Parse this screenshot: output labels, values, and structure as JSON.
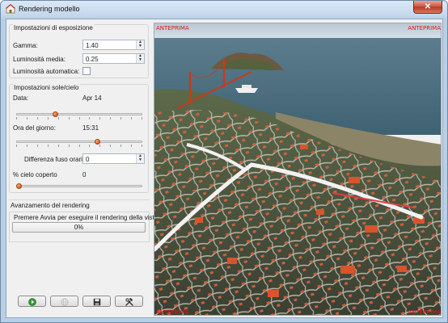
{
  "window": {
    "title": "Rendering modello",
    "close_glyph": "✕"
  },
  "exposure": {
    "group_title": "Impostazioni di esposizione",
    "gamma_label": "Gamma:",
    "gamma_value": "1.40",
    "brightness_label": "Luminosità media:",
    "brightness_value": "0.25",
    "auto_brightness_label": "Luminosità automatica:",
    "auto_brightness_checked": false
  },
  "sun_sky": {
    "group_title": "Impostazioni sole/cielo",
    "date_label": "Data:",
    "date_value": "Apr 14",
    "date_slider_level": 0.3,
    "time_label": "Ora del giorno:",
    "time_value": "15:31",
    "time_slider_level": 0.65,
    "timezone_label": "Differenza fuso orario:",
    "timezone_value": "0",
    "cloud_label": "% cielo coperto",
    "cloud_value": "0",
    "cloud_slider_level": 0.0
  },
  "rendering": {
    "section_title": "Avanzamento del rendering",
    "status_text": "Premere Avvia per eseguire il rendering della vista.",
    "progress_text": "0%",
    "progress_level": 0.0
  },
  "toolbar": {
    "buttons": [
      {
        "name": "start-render-button",
        "icon": "play-icon",
        "enabled": true
      },
      {
        "name": "stop-render-button",
        "icon": "globe-icon",
        "enabled": false
      },
      {
        "name": "save-image-button",
        "icon": "floppy-disk-icon",
        "enabled": true
      },
      {
        "name": "settings-button",
        "icon": "wrench-hammer-icon",
        "enabled": true
      }
    ]
  },
  "viewport": {
    "preview_label": "ANTEPRIMA",
    "label_color": "#e01818"
  }
}
